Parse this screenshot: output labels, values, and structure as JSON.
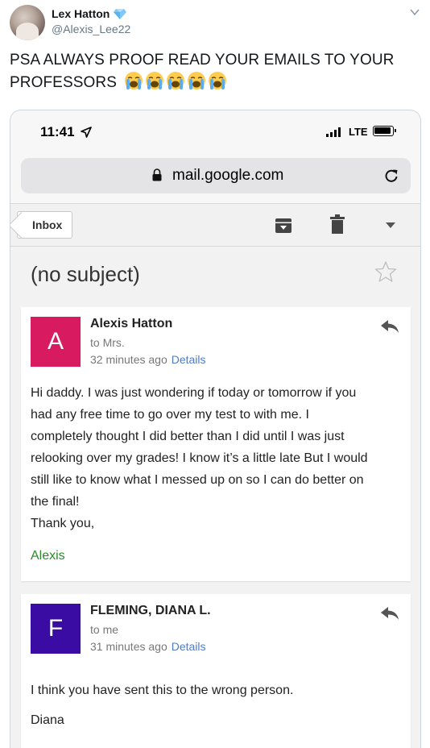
{
  "tweet": {
    "display_name": "Lex Hatton",
    "handle": "@Alexis_Lee22",
    "text": "PSA ALWAYS PROOF READ YOUR EMAILS TO YOUR PROFESSORS",
    "emoji": [
      "loudly-crying-face",
      "loudly-crying-face",
      "loudly-crying-face",
      "loudly-crying-face",
      "loudly-crying-face"
    ]
  },
  "phone": {
    "time": "11:41",
    "carrier": "LTE",
    "url": "mail.google.com"
  },
  "toolbar": {
    "back_label": "Inbox"
  },
  "email": {
    "subject": "(no subject)",
    "messages": [
      {
        "avatar_letter": "A",
        "avatar_color": "#d81b60",
        "sender": "Alexis Hatton",
        "to": "to Mrs.",
        "time": "32 minutes ago",
        "details_label": "Details",
        "body_lines": [
          "Hi daddy. I was just wondering if today or tomorrow if you",
          "had any free time to go over my test to with me. I",
          "completely thought I did better than I did until I was just",
          "relooking over my grades! I know it’s a little late But I would",
          "still like to know what I messed up on so I can do better on",
          "the final!",
          "Thank you,"
        ],
        "signature": "Alexis"
      },
      {
        "avatar_letter": "F",
        "avatar_color": "#3a0ca3",
        "sender": "FLEMING, DIANA L.",
        "to": "to me",
        "time": "31 minutes ago",
        "details_label": "Details",
        "body_lines": [
          "I think you have sent this to the wrong person.",
          "Diana"
        ]
      }
    ]
  }
}
